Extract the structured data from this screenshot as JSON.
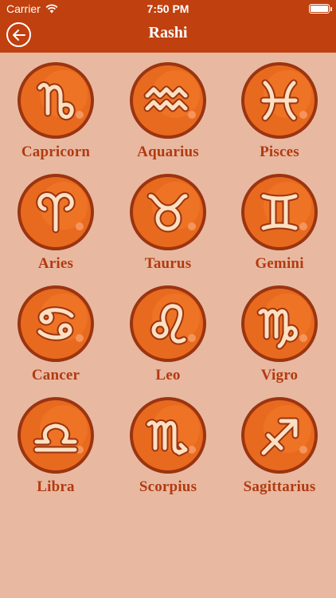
{
  "status_bar": {
    "carrier": "Carrier",
    "time": "7:50 PM"
  },
  "nav": {
    "title": "Rashi",
    "back_icon": "arrow-left-circle-icon"
  },
  "colors": {
    "header": "#c0400f",
    "background": "#e8b9a0",
    "medal": "#e86a1f",
    "medal_rim": "#9b3410",
    "glyph": "#fde0c2",
    "label": "#b23a12"
  },
  "signs": [
    {
      "name": "Capricorn",
      "icon": "capricorn-icon"
    },
    {
      "name": "Aquarius",
      "icon": "aquarius-icon"
    },
    {
      "name": "Pisces",
      "icon": "pisces-icon"
    },
    {
      "name": "Aries",
      "icon": "aries-icon"
    },
    {
      "name": "Taurus",
      "icon": "taurus-icon"
    },
    {
      "name": "Gemini",
      "icon": "gemini-icon"
    },
    {
      "name": "Cancer",
      "icon": "cancer-icon"
    },
    {
      "name": "Leo",
      "icon": "leo-icon"
    },
    {
      "name": "Vigro",
      "icon": "virgo-icon"
    },
    {
      "name": "Libra",
      "icon": "libra-icon"
    },
    {
      "name": "Scorpius",
      "icon": "scorpio-icon"
    },
    {
      "name": "Sagittarius",
      "icon": "sagittarius-icon"
    }
  ]
}
